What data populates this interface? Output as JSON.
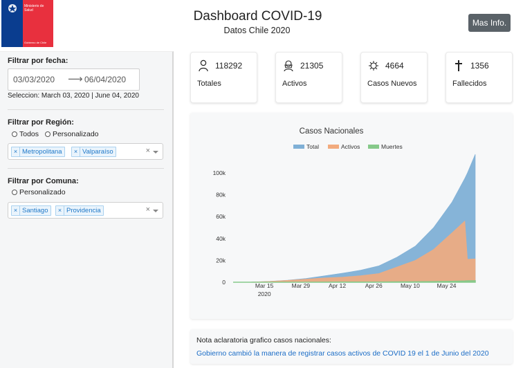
{
  "header": {
    "logo_line1": "Ministerio de Salud",
    "logo_line2": "Gobierno de Chile",
    "title": "Dashboard COVID-19",
    "subtitle": "Datos Chile 2020",
    "info_button": "Mas Info."
  },
  "sidebar": {
    "date_filter": {
      "label": "Filtrar por fecha:",
      "start": "03/03/2020",
      "arrow": "⟶",
      "end": "06/04/2020",
      "selection": "Seleccion: March 03, 2020 | June 04, 2020"
    },
    "region_filter": {
      "label": "Filtrar por Región:",
      "options": [
        "Todos",
        "Personalizado"
      ],
      "tags": [
        "Metropolitana",
        "Valparaíso"
      ],
      "clear": "×"
    },
    "commune_filter": {
      "label": "Filtrar por Comuna:",
      "options": [
        "Personalizado"
      ],
      "tags": [
        "Santiago",
        "Providencia"
      ],
      "clear": "×"
    }
  },
  "cards": [
    {
      "icon": "person-icon",
      "value": "118292",
      "label": "Totales"
    },
    {
      "icon": "mask-icon",
      "value": "21305",
      "label": "Activos"
    },
    {
      "icon": "virus-icon",
      "value": "4664",
      "label": "Casos Nuevos"
    },
    {
      "icon": "cross-icon",
      "value": "1356",
      "label": "Fallecidos"
    }
  ],
  "chart_data": {
    "type": "area",
    "title": "Casos Nacionales",
    "xlabel": "",
    "ylabel": "",
    "x_ticks": [
      "Mar 15",
      "Mar 29",
      "Apr 12",
      "Apr 26",
      "May 10",
      "May 24"
    ],
    "x_tick_year": "2020",
    "y_ticks": [
      "0",
      "20k",
      "40k",
      "60k",
      "80k",
      "100k"
    ],
    "ylim": [
      0,
      117000
    ],
    "x": [
      "2020-03-03",
      "2020-03-10",
      "2020-03-17",
      "2020-03-24",
      "2020-03-31",
      "2020-04-07",
      "2020-04-14",
      "2020-04-21",
      "2020-04-28",
      "2020-05-05",
      "2020-05-12",
      "2020-05-19",
      "2020-05-26",
      "2020-05-31",
      "2020-06-01",
      "2020-06-04"
    ],
    "series": [
      {
        "name": "Total",
        "color": "#7fb0d6",
        "values": [
          0,
          200,
          800,
          1900,
          3400,
          5800,
          8300,
          11000,
          15000,
          23000,
          33000,
          50000,
          73000,
          95000,
          100000,
          117000
        ]
      },
      {
        "name": "Activos",
        "color": "#f2ab7e",
        "values": [
          0,
          200,
          750,
          1700,
          2800,
          3900,
          4600,
          6000,
          8000,
          14000,
          20000,
          30000,
          45000,
          56000,
          21000,
          21305
        ]
      },
      {
        "name": "Muertes",
        "color": "#86c98a",
        "values": [
          0,
          0,
          0,
          2,
          12,
          50,
          100,
          160,
          220,
          290,
          390,
          560,
          840,
          1100,
          1250,
          1356
        ]
      }
    ],
    "grid": false,
    "legend_position": "top-center"
  },
  "note": {
    "title": "Nota aclaratoria grafico casos nacionales:",
    "link": "Gobierno cambió la manera de registrar casos activos de COVID 19 el 1 de Junio del 2020"
  }
}
